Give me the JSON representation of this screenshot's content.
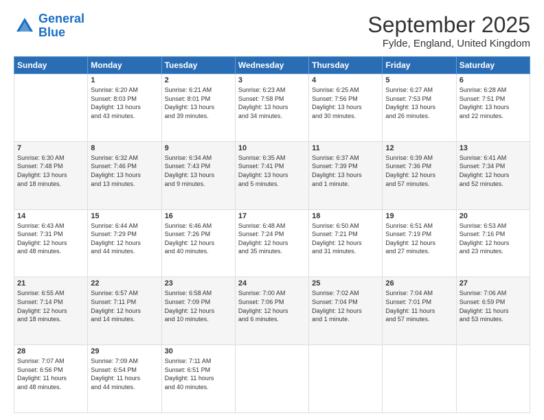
{
  "header": {
    "logo_line1": "General",
    "logo_line2": "Blue",
    "title": "September 2025",
    "subtitle": "Fylde, England, United Kingdom"
  },
  "days": [
    "Sunday",
    "Monday",
    "Tuesday",
    "Wednesday",
    "Thursday",
    "Friday",
    "Saturday"
  ],
  "weeks": [
    [
      {
        "day": "",
        "info": ""
      },
      {
        "day": "1",
        "info": "Sunrise: 6:20 AM\nSunset: 8:03 PM\nDaylight: 13 hours\nand 43 minutes."
      },
      {
        "day": "2",
        "info": "Sunrise: 6:21 AM\nSunset: 8:01 PM\nDaylight: 13 hours\nand 39 minutes."
      },
      {
        "day": "3",
        "info": "Sunrise: 6:23 AM\nSunset: 7:58 PM\nDaylight: 13 hours\nand 34 minutes."
      },
      {
        "day": "4",
        "info": "Sunrise: 6:25 AM\nSunset: 7:56 PM\nDaylight: 13 hours\nand 30 minutes."
      },
      {
        "day": "5",
        "info": "Sunrise: 6:27 AM\nSunset: 7:53 PM\nDaylight: 13 hours\nand 26 minutes."
      },
      {
        "day": "6",
        "info": "Sunrise: 6:28 AM\nSunset: 7:51 PM\nDaylight: 13 hours\nand 22 minutes."
      }
    ],
    [
      {
        "day": "7",
        "info": "Sunrise: 6:30 AM\nSunset: 7:48 PM\nDaylight: 13 hours\nand 18 minutes."
      },
      {
        "day": "8",
        "info": "Sunrise: 6:32 AM\nSunset: 7:46 PM\nDaylight: 13 hours\nand 13 minutes."
      },
      {
        "day": "9",
        "info": "Sunrise: 6:34 AM\nSunset: 7:43 PM\nDaylight: 13 hours\nand 9 minutes."
      },
      {
        "day": "10",
        "info": "Sunrise: 6:35 AM\nSunset: 7:41 PM\nDaylight: 13 hours\nand 5 minutes."
      },
      {
        "day": "11",
        "info": "Sunrise: 6:37 AM\nSunset: 7:39 PM\nDaylight: 13 hours\nand 1 minute."
      },
      {
        "day": "12",
        "info": "Sunrise: 6:39 AM\nSunset: 7:36 PM\nDaylight: 12 hours\nand 57 minutes."
      },
      {
        "day": "13",
        "info": "Sunrise: 6:41 AM\nSunset: 7:34 PM\nDaylight: 12 hours\nand 52 minutes."
      }
    ],
    [
      {
        "day": "14",
        "info": "Sunrise: 6:43 AM\nSunset: 7:31 PM\nDaylight: 12 hours\nand 48 minutes."
      },
      {
        "day": "15",
        "info": "Sunrise: 6:44 AM\nSunset: 7:29 PM\nDaylight: 12 hours\nand 44 minutes."
      },
      {
        "day": "16",
        "info": "Sunrise: 6:46 AM\nSunset: 7:26 PM\nDaylight: 12 hours\nand 40 minutes."
      },
      {
        "day": "17",
        "info": "Sunrise: 6:48 AM\nSunset: 7:24 PM\nDaylight: 12 hours\nand 35 minutes."
      },
      {
        "day": "18",
        "info": "Sunrise: 6:50 AM\nSunset: 7:21 PM\nDaylight: 12 hours\nand 31 minutes."
      },
      {
        "day": "19",
        "info": "Sunrise: 6:51 AM\nSunset: 7:19 PM\nDaylight: 12 hours\nand 27 minutes."
      },
      {
        "day": "20",
        "info": "Sunrise: 6:53 AM\nSunset: 7:16 PM\nDaylight: 12 hours\nand 23 minutes."
      }
    ],
    [
      {
        "day": "21",
        "info": "Sunrise: 6:55 AM\nSunset: 7:14 PM\nDaylight: 12 hours\nand 18 minutes."
      },
      {
        "day": "22",
        "info": "Sunrise: 6:57 AM\nSunset: 7:11 PM\nDaylight: 12 hours\nand 14 minutes."
      },
      {
        "day": "23",
        "info": "Sunrise: 6:58 AM\nSunset: 7:09 PM\nDaylight: 12 hours\nand 10 minutes."
      },
      {
        "day": "24",
        "info": "Sunrise: 7:00 AM\nSunset: 7:06 PM\nDaylight: 12 hours\nand 6 minutes."
      },
      {
        "day": "25",
        "info": "Sunrise: 7:02 AM\nSunset: 7:04 PM\nDaylight: 12 hours\nand 1 minute."
      },
      {
        "day": "26",
        "info": "Sunrise: 7:04 AM\nSunset: 7:01 PM\nDaylight: 11 hours\nand 57 minutes."
      },
      {
        "day": "27",
        "info": "Sunrise: 7:06 AM\nSunset: 6:59 PM\nDaylight: 11 hours\nand 53 minutes."
      }
    ],
    [
      {
        "day": "28",
        "info": "Sunrise: 7:07 AM\nSunset: 6:56 PM\nDaylight: 11 hours\nand 48 minutes."
      },
      {
        "day": "29",
        "info": "Sunrise: 7:09 AM\nSunset: 6:54 PM\nDaylight: 11 hours\nand 44 minutes."
      },
      {
        "day": "30",
        "info": "Sunrise: 7:11 AM\nSunset: 6:51 PM\nDaylight: 11 hours\nand 40 minutes."
      },
      {
        "day": "",
        "info": ""
      },
      {
        "day": "",
        "info": ""
      },
      {
        "day": "",
        "info": ""
      },
      {
        "day": "",
        "info": ""
      }
    ]
  ]
}
